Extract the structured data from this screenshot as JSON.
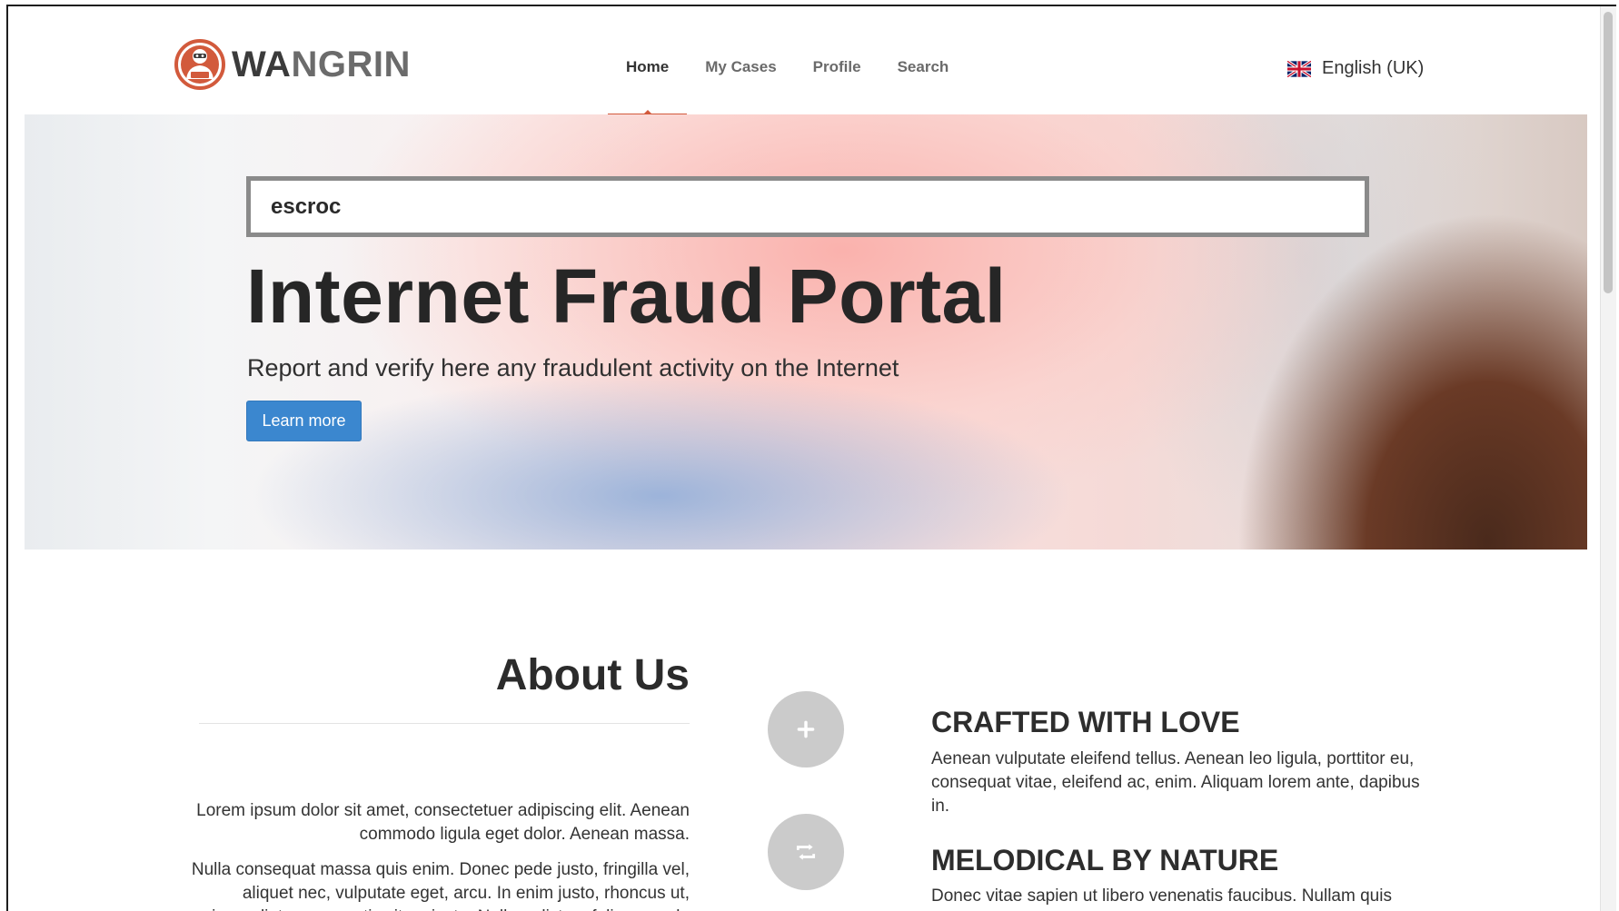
{
  "brand": {
    "name_part1": "WA",
    "name_part2": "NGRIN",
    "accent_color": "#d25a3c"
  },
  "nav": {
    "items": [
      {
        "label": "Home",
        "active": true
      },
      {
        "label": "My Cases",
        "active": false
      },
      {
        "label": "Profile",
        "active": false
      },
      {
        "label": "Search",
        "active": false
      }
    ],
    "language": {
      "label": "English (UK)",
      "icon": "uk-flag-icon"
    }
  },
  "hero": {
    "search_value": "escroc",
    "title": "Internet Fraud Portal",
    "subtitle": "Report and verify here any fraudulent activity on the Internet",
    "button_label": "Learn more",
    "button_color": "#3b87cf"
  },
  "about": {
    "title": "About Us",
    "paragraphs": [
      "Lorem ipsum dolor sit amet, consectetuer adipiscing elit. Aenean commodo ligula eget dolor. Aenean massa.",
      "Nulla consequat massa quis enim. Donec pede justo, fringilla vel, aliquet nec, vulputate eget, arcu. In enim justo, rhoncus ut, imperdiet a, venenatis vitae, justo. Nullam dictum felis eu pede"
    ]
  },
  "features": [
    {
      "icon": "plus-icon",
      "title": "CRAFTED WITH LOVE",
      "description": "Aenean vulputate eleifend tellus. Aenean leo ligula, porttitor eu, consequat vitae, eleifend ac, enim. Aliquam lorem ante, dapibus in."
    },
    {
      "icon": "retweet-icon",
      "title": "MELODICAL BY NATURE",
      "description": "Donec vitae sapien ut libero venenatis faucibus. Nullam quis ante. Etiam sit amet orci eget eros faucibus tincidunt."
    }
  ]
}
